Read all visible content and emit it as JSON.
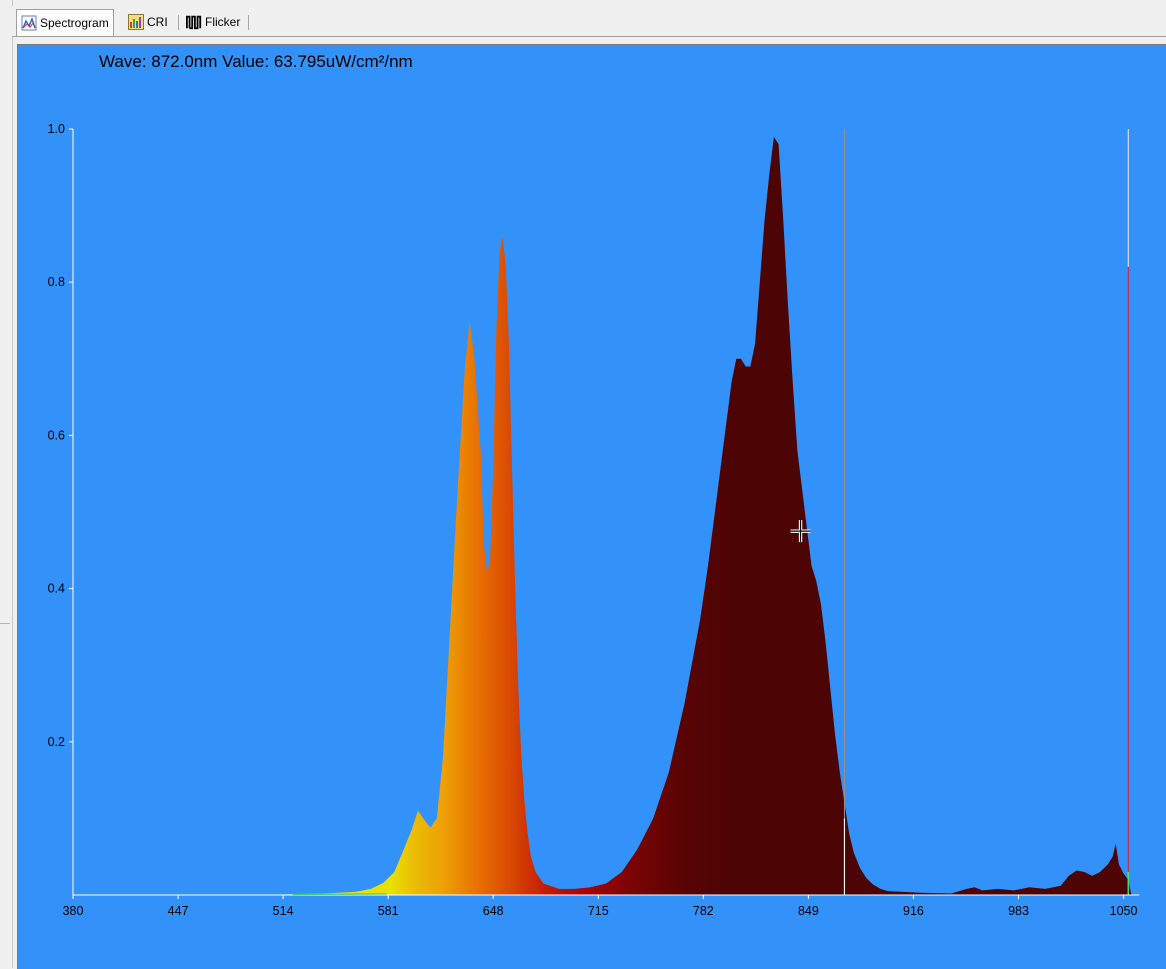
{
  "tabs": [
    {
      "label": "Spectrogram",
      "icon": "spectrogram-icon",
      "active": true
    },
    {
      "label": "CRI",
      "icon": "cri-icon",
      "active": false
    },
    {
      "label": "Flicker",
      "icon": "flicker-icon",
      "active": false
    }
  ],
  "readout": {
    "text": "Wave: 872.0nm  Value: 63.795uW/cm²/nm"
  },
  "colors": {
    "plot_background": "#3392fa",
    "axis": "#ffffff",
    "far_red_fill": "#4d0404"
  },
  "chart_data": {
    "type": "area",
    "title": "",
    "xlabel": "",
    "ylabel": "",
    "xlim": [
      380,
      1060
    ],
    "ylim": [
      0,
      1.0
    ],
    "x_ticks": [
      380,
      447,
      514,
      581,
      648,
      715,
      782,
      849,
      916,
      983,
      1050
    ],
    "x_tick_labels": [
      "380",
      "447",
      "514",
      "581",
      "648",
      "715",
      "782",
      "849",
      "916",
      "983",
      "1050"
    ],
    "y_ticks": [
      0.2,
      0.4,
      0.6,
      0.8,
      1.0
    ],
    "y_tick_labels": [
      "0.2",
      "0.4",
      "0.6",
      "0.8",
      "1.0"
    ],
    "grid": false,
    "cursor_line_nm": 872,
    "marker_line_nm": 1053,
    "series": [
      {
        "x": [
          380,
          500,
          540,
          560,
          570,
          578,
          585,
          590,
          596,
          600,
          604,
          608,
          612,
          616,
          620,
          625,
          630,
          633,
          636,
          640,
          642,
          644,
          646,
          648,
          650,
          652,
          654,
          656,
          658,
          660,
          662,
          664,
          666,
          668,
          670,
          672,
          675,
          680,
          690,
          700,
          710,
          720,
          730,
          740,
          750,
          760,
          770,
          780,
          785,
          790,
          795,
          800,
          803,
          806,
          809,
          812,
          815,
          818,
          821,
          824,
          827,
          830,
          833,
          836,
          839,
          842,
          845,
          848,
          851,
          854,
          857,
          860,
          863,
          866,
          869,
          872,
          875,
          878,
          882,
          886,
          890,
          895,
          900,
          910,
          920,
          940,
          950,
          955,
          960,
          970,
          980,
          990,
          1000,
          1010,
          1015,
          1020,
          1025,
          1030,
          1035,
          1040,
          1043,
          1045,
          1047,
          1050,
          1053,
          1055
        ],
        "y": [
          0,
          0,
          0.002,
          0.004,
          0.008,
          0.016,
          0.03,
          0.055,
          0.085,
          0.11,
          0.098,
          0.088,
          0.1,
          0.18,
          0.33,
          0.52,
          0.69,
          0.75,
          0.7,
          0.58,
          0.46,
          0.42,
          0.44,
          0.56,
          0.74,
          0.84,
          0.86,
          0.82,
          0.72,
          0.56,
          0.4,
          0.27,
          0.18,
          0.12,
          0.08,
          0.05,
          0.03,
          0.015,
          0.008,
          0.008,
          0.01,
          0.015,
          0.03,
          0.06,
          0.1,
          0.16,
          0.25,
          0.36,
          0.43,
          0.51,
          0.59,
          0.67,
          0.7,
          0.7,
          0.69,
          0.69,
          0.72,
          0.8,
          0.88,
          0.94,
          0.99,
          0.98,
          0.88,
          0.77,
          0.67,
          0.58,
          0.53,
          0.48,
          0.43,
          0.41,
          0.38,
          0.33,
          0.27,
          0.21,
          0.16,
          0.12,
          0.08,
          0.055,
          0.035,
          0.022,
          0.014,
          0.008,
          0.005,
          0.004,
          0.003,
          0.002,
          0.008,
          0.01,
          0.006,
          0.008,
          0.006,
          0.01,
          0.008,
          0.012,
          0.025,
          0.032,
          0.03,
          0.025,
          0.03,
          0.04,
          0.05,
          0.067,
          0.04,
          0.028,
          0.02,
          0
        ]
      }
    ]
  }
}
